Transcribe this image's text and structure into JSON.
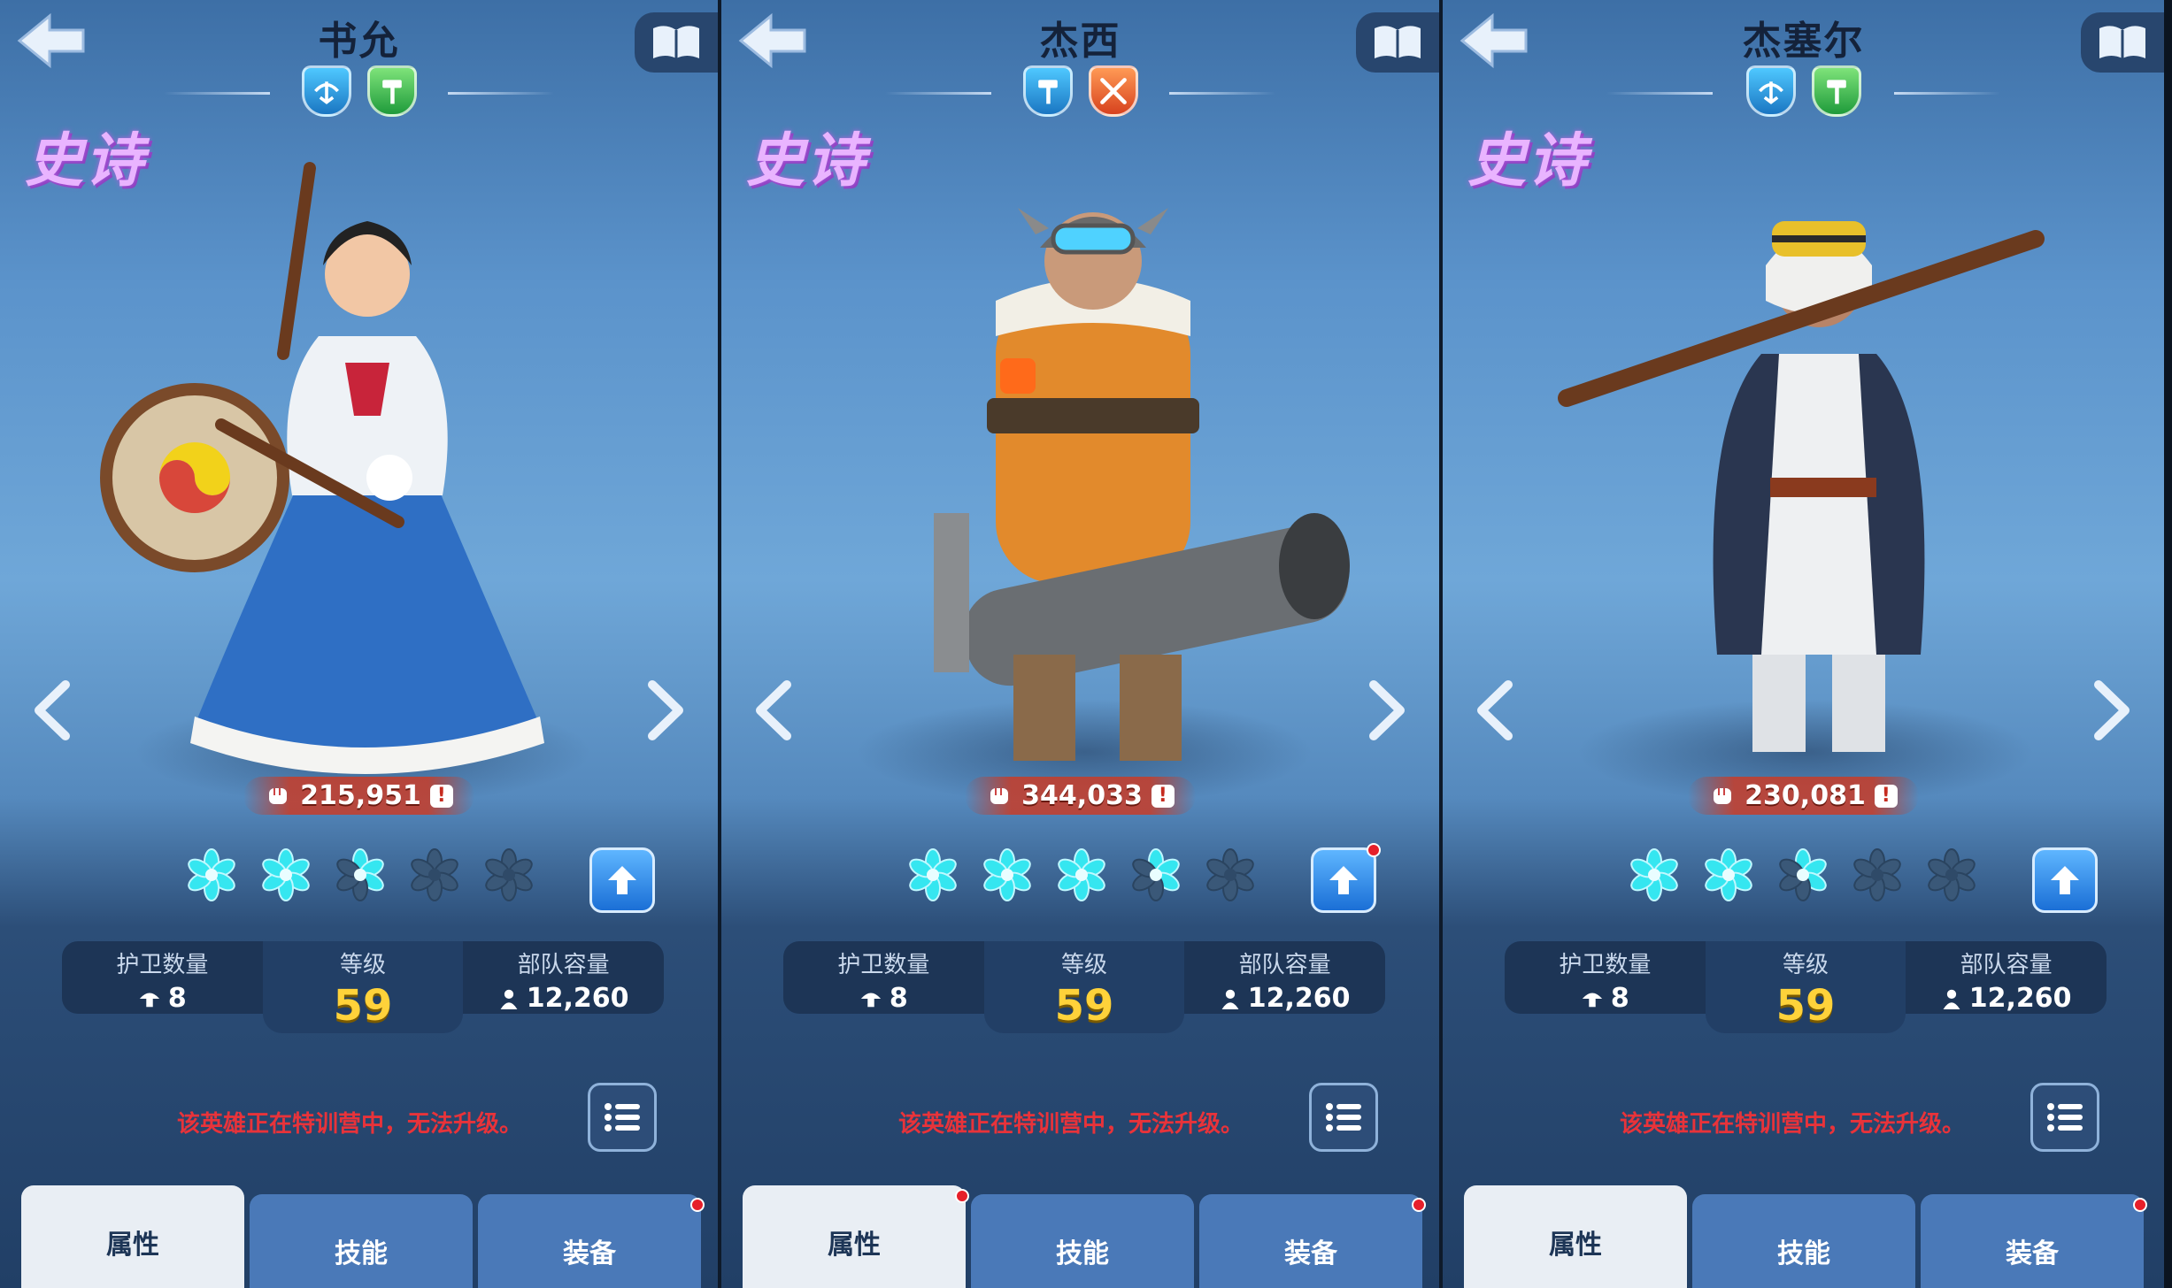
{
  "panels": [
    {
      "name": "书允",
      "classes": [
        "badge-blue",
        "badge-green"
      ],
      "class_icons": [
        "crossbow-icon",
        "hammer-icon"
      ],
      "rarity": "史诗",
      "power": "215,951",
      "stars": 2.5,
      "upgrade_dot": false,
      "guards_label": "护卫数量",
      "guards_value": "8",
      "level_label": "等级",
      "level_value": "59",
      "capacity_label": "部队容量",
      "capacity_value": "12,260",
      "notice": "该英雄正在特训营中，无法升级。",
      "tabs": [
        {
          "label": "属性",
          "active": true,
          "dot": false
        },
        {
          "label": "技能",
          "active": false,
          "dot": false
        },
        {
          "label": "装备",
          "active": false,
          "dot": true
        }
      ],
      "theme": "drum"
    },
    {
      "name": "杰西",
      "classes": [
        "badge-blue",
        "badge-orange"
      ],
      "class_icons": [
        "hammer-icon",
        "crossed-swords-icon"
      ],
      "rarity": "史诗",
      "power": "344,033",
      "stars": 3.5,
      "upgrade_dot": true,
      "guards_label": "护卫数量",
      "guards_value": "8",
      "level_label": "等级",
      "level_value": "59",
      "capacity_label": "部队容量",
      "capacity_value": "12,260",
      "notice": "该英雄正在特训营中，无法升级。",
      "tabs": [
        {
          "label": "属性",
          "active": true,
          "dot": true
        },
        {
          "label": "技能",
          "active": false,
          "dot": false
        },
        {
          "label": "装备",
          "active": false,
          "dot": true
        }
      ],
      "theme": "cannon"
    },
    {
      "name": "杰塞尔",
      "classes": [
        "badge-blue",
        "badge-green"
      ],
      "class_icons": [
        "crossbow-icon",
        "hammer-icon"
      ],
      "rarity": "史诗",
      "power": "230,081",
      "stars": 2.5,
      "upgrade_dot": false,
      "guards_label": "护卫数量",
      "guards_value": "8",
      "level_label": "等级",
      "level_value": "59",
      "capacity_label": "部队容量",
      "capacity_value": "12,260",
      "notice": "该英雄正在特训营中，无法升级。",
      "tabs": [
        {
          "label": "属性",
          "active": true,
          "dot": false
        },
        {
          "label": "技能",
          "active": false,
          "dot": false
        },
        {
          "label": "装备",
          "active": false,
          "dot": true
        }
      ],
      "theme": "rifle"
    }
  ],
  "colors": {
    "rarity": "#e9b4ff",
    "level": "#ffd23a",
    "notice": "#e8333a",
    "star_on": "#35e6f0",
    "star_off": "#3a5878"
  }
}
